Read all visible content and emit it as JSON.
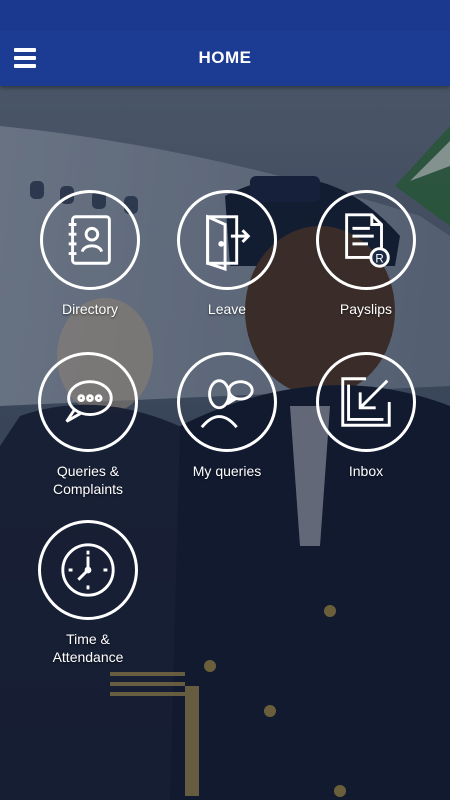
{
  "header": {
    "title": "HOME",
    "menu_icon": "hamburger-icon",
    "color": "#1c3c94"
  },
  "tiles": [
    {
      "label": "Directory",
      "icon": "address-book-icon"
    },
    {
      "label": "Leave",
      "icon": "door-exit-icon"
    },
    {
      "label": "Payslips",
      "icon": "payslip-document-icon"
    },
    {
      "label": "Queries &\nComplaints",
      "icon": "speech-bubble-icon"
    },
    {
      "label": "My queries",
      "icon": "person-chat-icon"
    },
    {
      "label": "Inbox",
      "icon": "inbox-arrow-icon"
    },
    {
      "label": "Time &\nAttendance",
      "icon": "clock-icon"
    }
  ]
}
